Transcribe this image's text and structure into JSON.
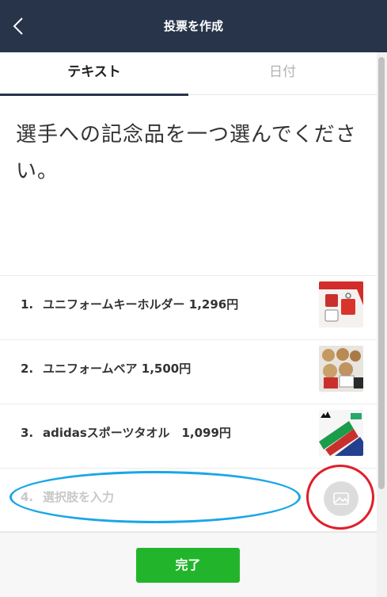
{
  "header": {
    "title": "投票を作成",
    "back_icon": "chevron-left-icon"
  },
  "tabs": [
    {
      "label": "テキスト",
      "active": true
    },
    {
      "label": "日付",
      "active": false
    }
  ],
  "question": "選手への記念品を一つ選んでください。",
  "options": [
    {
      "number": "1.",
      "label": "ユニフォームキーホルダー 1,296円",
      "image": "keychain-thumbnail"
    },
    {
      "number": "2.",
      "label": "ユニフォームベア 1,500円",
      "image": "bear-thumbnail"
    },
    {
      "number": "3.",
      "label": "adidasスポーツタオル　1,099円",
      "image": "towel-thumbnail"
    }
  ],
  "new_option": {
    "number": "4.",
    "placeholder": "選択肢を入力",
    "photo_icon": "add-photo-icon"
  },
  "footer": {
    "done_label": "完了"
  },
  "colors": {
    "header_bg": "#27344a",
    "done_button": "#22b52c",
    "annotation_blue": "#1aa6e8",
    "annotation_red": "#e11d2a"
  }
}
